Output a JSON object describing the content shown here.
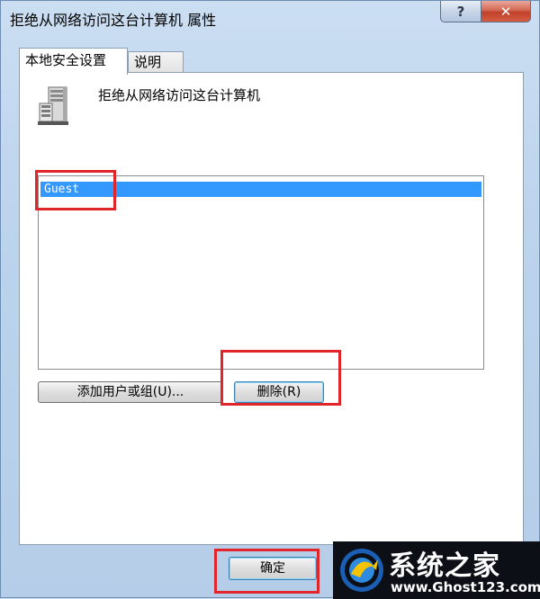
{
  "window": {
    "title": "拒绝从网络访问这台计算机 属性",
    "help_label": "?",
    "close_label": "✕"
  },
  "tabs": [
    {
      "label": "本地安全设置",
      "active": true
    },
    {
      "label": "说明",
      "active": false
    }
  ],
  "policy": {
    "icon": "server-icon",
    "title": "拒绝从网络访问这台计算机"
  },
  "list": {
    "items": [
      {
        "label": "Guest",
        "selected": true
      }
    ]
  },
  "buttons": {
    "add_label": "添加用户或组(U)...",
    "remove_label": "删除(R)",
    "ok_label": "确定"
  },
  "watermark": {
    "title": "系统之家",
    "url": "www.Ghost123.com"
  },
  "colors": {
    "highlight": "#e0252b",
    "selection": "#3399ff"
  }
}
